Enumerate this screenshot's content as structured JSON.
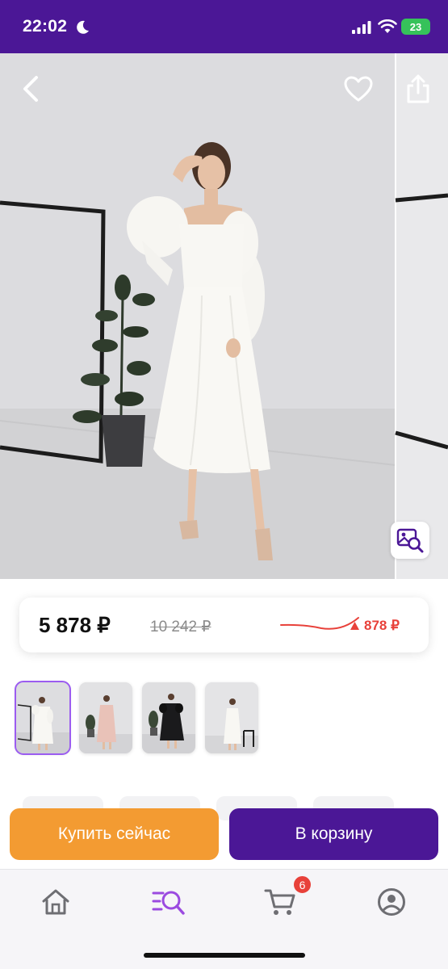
{
  "status_bar": {
    "time": "22:02",
    "battery": "23",
    "background": "#4b1796"
  },
  "hero": {
    "icons": [
      "back-arrow-icon",
      "heart-icon",
      "share-icon",
      "visual-search-icon"
    ]
  },
  "price": {
    "current": "5 878 ₽",
    "old": "10 242 ₽",
    "change": "878 ₽",
    "change_color": "#e8413a"
  },
  "thumbnails": [
    {
      "name": "white-dress",
      "selected": true
    },
    {
      "name": "pink-dress",
      "selected": false
    },
    {
      "name": "black-dress",
      "selected": false
    },
    {
      "name": "white-dress-chair",
      "selected": false
    }
  ],
  "actions": {
    "buy_now": "Купить сейчас",
    "add_to_cart": "В корзину",
    "buy_color": "#f39b32",
    "cart_color": "#4b1796"
  },
  "tab_bar": {
    "items": [
      {
        "icon": "home-icon"
      },
      {
        "icon": "catalog-search-icon",
        "active": true
      },
      {
        "icon": "cart-icon",
        "badge": "6"
      },
      {
        "icon": "profile-icon"
      }
    ],
    "active_color": "#9b4ae0"
  }
}
